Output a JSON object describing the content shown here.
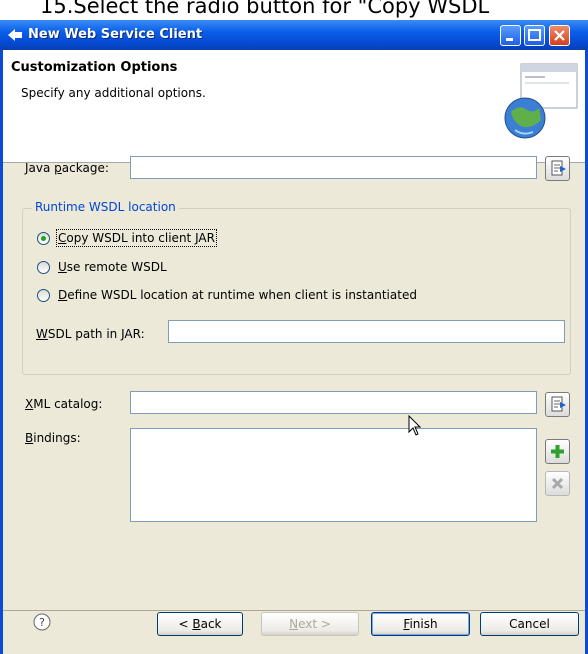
{
  "caption": "15.Select the radio button for \"Copy WSDL",
  "window": {
    "title": "New Web Service Client"
  },
  "header": {
    "title": "Customization Options",
    "description": "Specify any additional options."
  },
  "form": {
    "java_package": {
      "label_pre": "Java ",
      "label_u": "p",
      "label_post": "ackage:",
      "value": ""
    },
    "runtime_group": {
      "title": "Runtime WSDL location",
      "options": [
        {
          "pre": "",
          "u": "C",
          "post": "opy WSDL into client JAR",
          "selected": true
        },
        {
          "pre": "",
          "u": "U",
          "post": "se remote WSDL",
          "selected": false
        },
        {
          "pre": "",
          "u": "D",
          "post": "efine WSDL location at runtime when client is instantiated",
          "selected": false
        }
      ],
      "wsdl_path": {
        "label_pre": "",
        "label_u": "W",
        "label_post": "SDL path in JAR:",
        "value": ""
      }
    },
    "xml_catalog": {
      "label_pre": "",
      "label_u": "X",
      "label_post": "ML catalog:",
      "value": ""
    },
    "bindings": {
      "label_pre": "",
      "label_u": "B",
      "label_post": "indings:"
    }
  },
  "buttons": {
    "back": {
      "pre": "< ",
      "u": "B",
      "post": "ack"
    },
    "next": {
      "pre": "",
      "u": "N",
      "post": "ext >"
    },
    "finish": {
      "pre": "",
      "u": "F",
      "post": "inish"
    },
    "cancel": {
      "label": "Cancel"
    }
  },
  "icons": {
    "app": "eclipse-icon",
    "help": "help-icon",
    "browse": "browse-icon",
    "add": "plus-icon",
    "remove": "remove-icon",
    "banner": "globe-window-icon"
  },
  "colors": {
    "titlebar": "#0648d0",
    "dialog_bg": "#ece9d8",
    "group_title": "#0046d5",
    "add_icon": "#2ea12e"
  }
}
